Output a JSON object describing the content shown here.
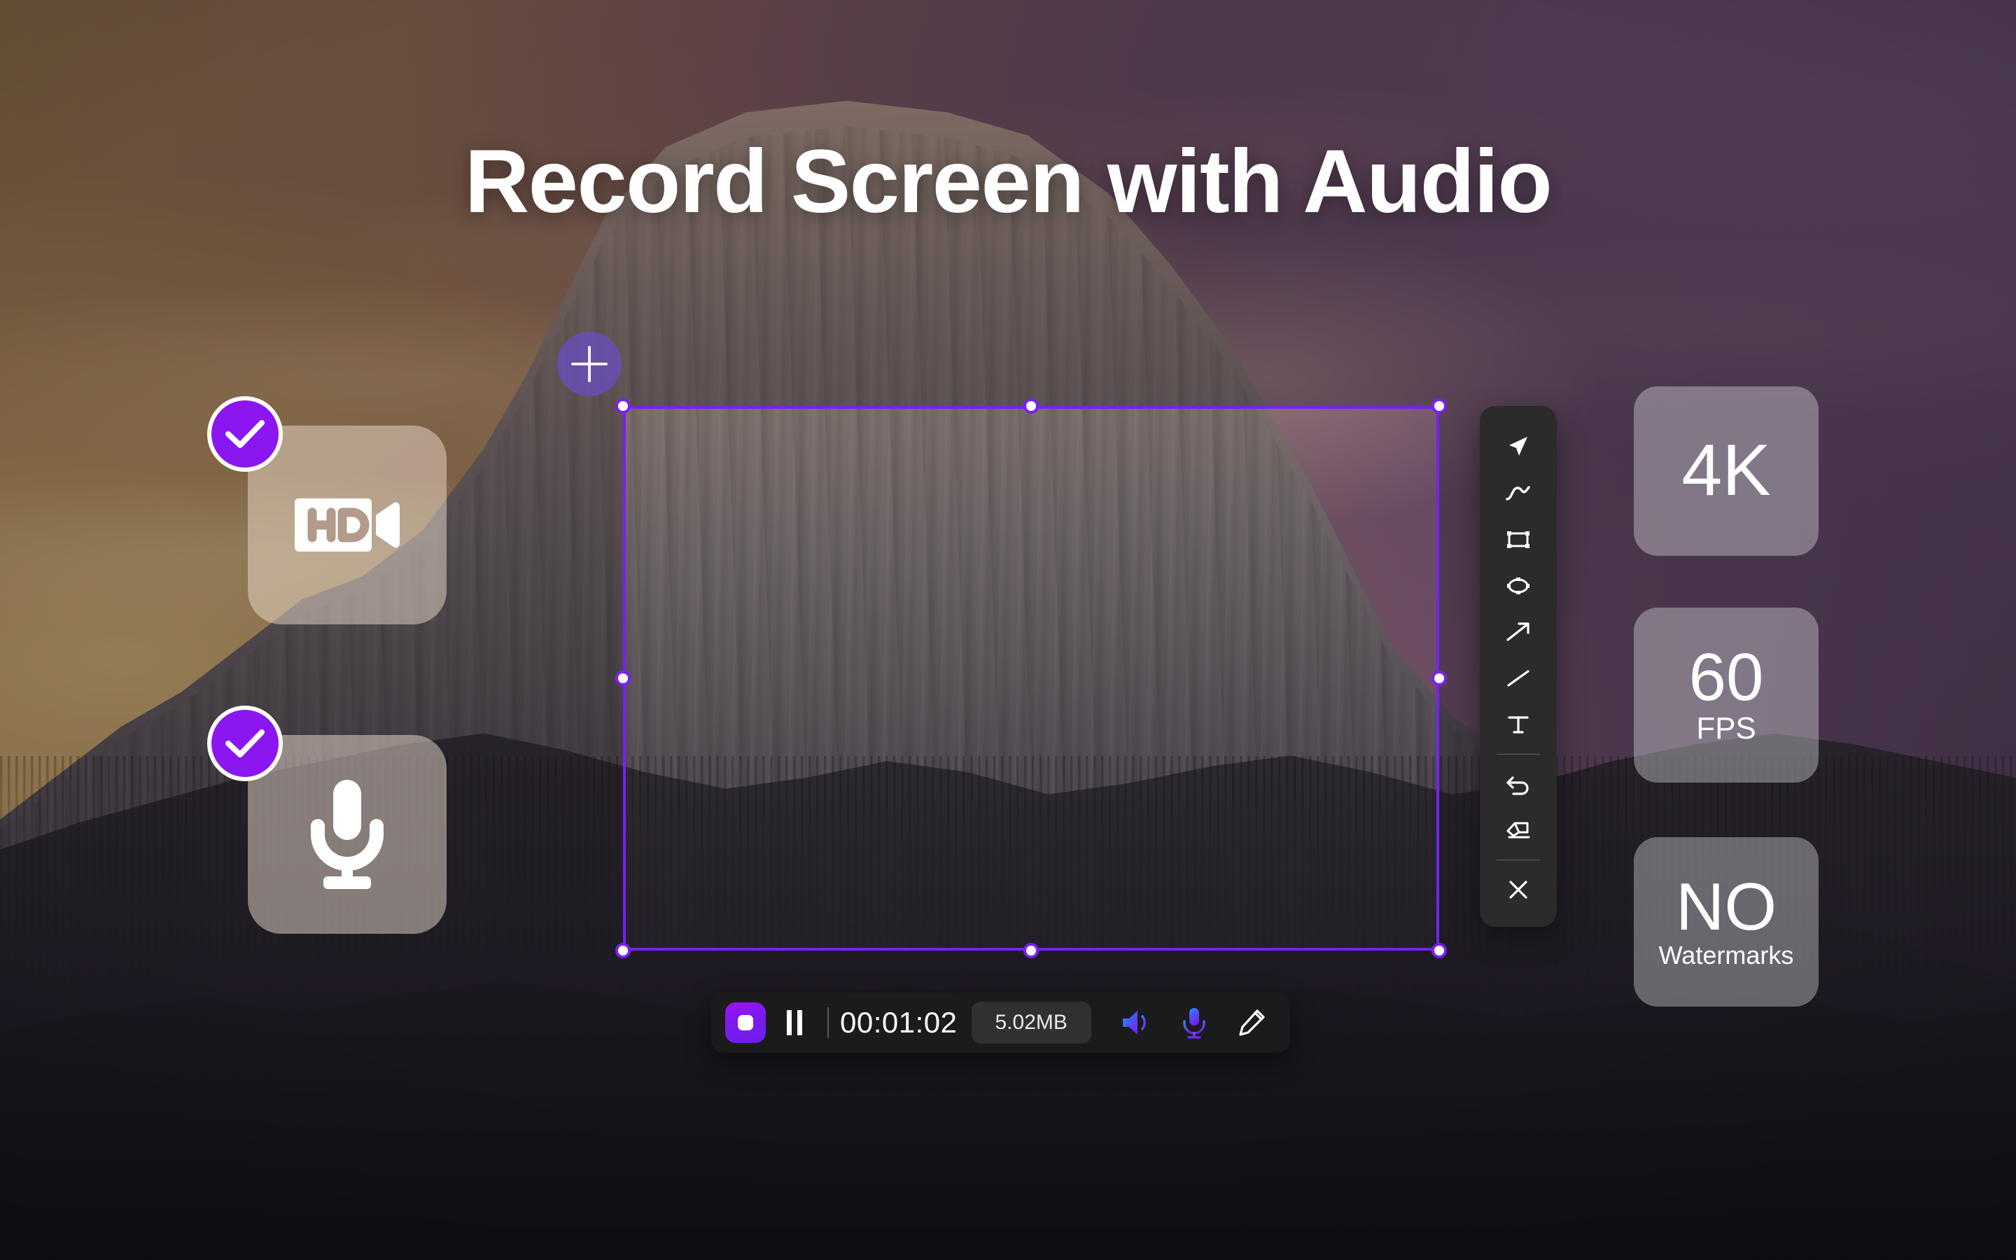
{
  "headline": "Record Screen with Audio",
  "colors": {
    "accent_purple": "#8B17F0",
    "selection_border": "#7A20F0",
    "toolbar_bg": "#2B2B2B",
    "controlbar_bg": "#1B1B1B",
    "size_pill_bg": "#303030",
    "icon_gradient_start": "#1E90FF",
    "icon_gradient_end": "#7A1BEF",
    "badge_glass": "rgba(226,228,232,0.38)",
    "feature_card_glass": "rgba(236,220,206,0.50)"
  },
  "feature_cards": [
    {
      "id": "hd",
      "icon": "hd-video-camera-icon",
      "label": "HD",
      "checked": true,
      "check_icon": "check-icon"
    },
    {
      "id": "microphone",
      "icon": "microphone-icon",
      "label": "",
      "checked": true,
      "check_icon": "check-icon"
    }
  ],
  "capture_region": {
    "add_button_icon": "plus-icon",
    "handles": [
      "top-left",
      "top-center",
      "top-right",
      "middle-left",
      "middle-right",
      "bottom-left",
      "bottom-center",
      "bottom-right"
    ]
  },
  "annotation_toolbar": {
    "tools": [
      {
        "name": "cursor-arrow-icon",
        "label": "Select"
      },
      {
        "name": "pen-curve-icon",
        "label": "Pen"
      },
      {
        "name": "rectangle-icon",
        "label": "Rectangle"
      },
      {
        "name": "ellipse-icon",
        "label": "Ellipse"
      },
      {
        "name": "arrow-icon",
        "label": "Arrow"
      },
      {
        "name": "line-icon",
        "label": "Line"
      },
      {
        "name": "text-icon",
        "label": "Text"
      }
    ],
    "actions": [
      {
        "name": "undo-icon",
        "label": "Undo"
      },
      {
        "name": "eraser-icon",
        "label": "Eraser"
      }
    ],
    "close": {
      "name": "close-icon",
      "label": "Close"
    }
  },
  "spec_badges": [
    {
      "id": "resolution",
      "primary": "4K",
      "secondary": ""
    },
    {
      "id": "framerate",
      "primary": "60",
      "secondary": "FPS"
    },
    {
      "id": "watermark",
      "primary": "NO",
      "secondary": "Watermarks"
    }
  ],
  "control_bar": {
    "stop_button": {
      "icon": "stop-icon",
      "label": "Stop"
    },
    "pause_button": {
      "icon": "pause-icon",
      "label": "Pause"
    },
    "timer": "00:01:02",
    "file_size": "5.02MB",
    "icons": [
      {
        "name": "speaker-volume-icon",
        "label": "System audio"
      },
      {
        "name": "microphone-icon",
        "label": "Microphone"
      },
      {
        "name": "pencil-edit-icon",
        "label": "Annotate"
      }
    ]
  }
}
